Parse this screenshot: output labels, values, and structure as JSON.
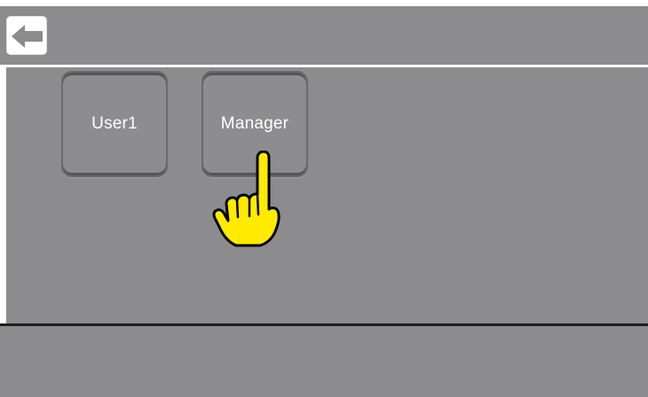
{
  "header": {
    "back_icon": "arrow-left-icon"
  },
  "users": {
    "items": [
      {
        "label": "User1"
      },
      {
        "label": "Manager"
      }
    ]
  },
  "overlay": {
    "pointer_icon": "pointing-hand-icon",
    "pointer_color": "#ffea00"
  },
  "colors": {
    "panel": "#8c8c8e",
    "button_text": "#ffffff",
    "divider": "#1e1e1e"
  }
}
